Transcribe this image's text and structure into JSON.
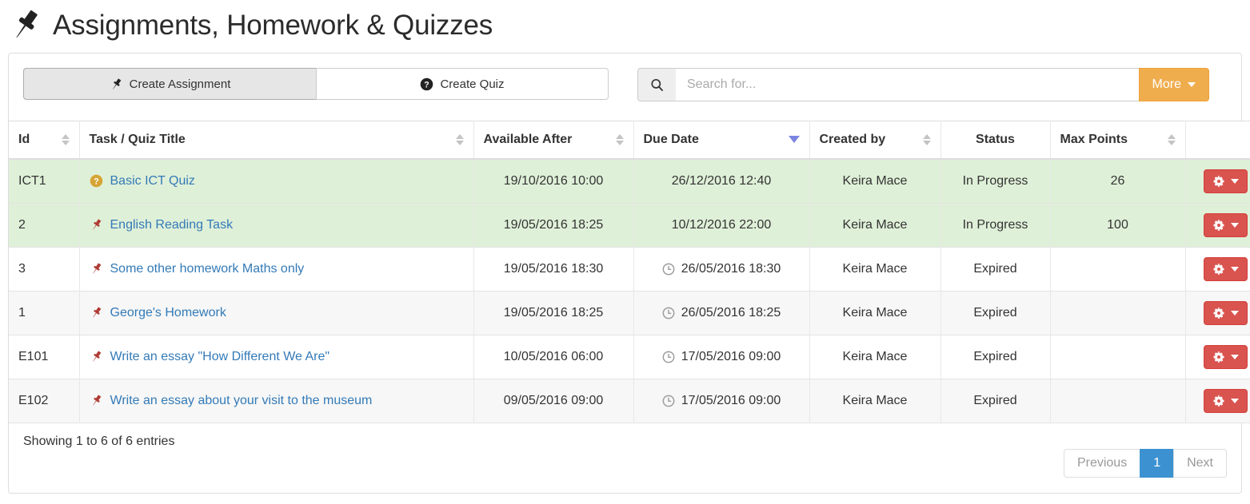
{
  "header": {
    "icon": "pin-icon",
    "title": "Assignments, Homework & Quizzes"
  },
  "toolbar": {
    "create_assignment_label": "Create Assignment",
    "create_assignment_icon": "pin-icon",
    "create_quiz_label": "Create Quiz",
    "create_quiz_icon": "question-circle-icon",
    "search_icon": "search-icon",
    "search_value": "",
    "search_placeholder": "Search for...",
    "more_label": "More",
    "more_caret_icon": "caret-down-icon"
  },
  "table": {
    "columns": [
      {
        "label": "Id",
        "sortable": true,
        "sorted": "none",
        "align": "left"
      },
      {
        "label": "Task / Quiz Title",
        "sortable": true,
        "sorted": "none",
        "align": "left"
      },
      {
        "label": "Available After",
        "sortable": true,
        "sorted": "none",
        "align": "center"
      },
      {
        "label": "Due Date",
        "sortable": true,
        "sorted": "desc",
        "align": "center"
      },
      {
        "label": "Created by",
        "sortable": true,
        "sorted": "none",
        "align": "center"
      },
      {
        "label": "Status",
        "sortable": false,
        "sorted": "none",
        "align": "center"
      },
      {
        "label": "Max Points",
        "sortable": true,
        "sorted": "none",
        "align": "center"
      },
      {
        "label": "",
        "sortable": false,
        "sorted": "none",
        "align": "center"
      }
    ],
    "rows": [
      {
        "id": "ICT1",
        "title": "Basic ICT Quiz",
        "title_icon": "question-circle-icon",
        "available_after": "19/10/2016 10:00",
        "due_date": "26/12/2016 12:40",
        "due_icon": "",
        "created_by": "Keira Mace",
        "status": "In Progress",
        "max_points": "26",
        "action_icon": "gear-icon",
        "action_caret_icon": "caret-down-icon",
        "row_style": "success"
      },
      {
        "id": "2",
        "title": "English Reading Task",
        "title_icon": "pin-icon",
        "available_after": "19/05/2016 18:25",
        "due_date": "10/12/2016 22:00",
        "due_icon": "",
        "created_by": "Keira Mace",
        "status": "In Progress",
        "max_points": "100",
        "action_icon": "gear-icon",
        "action_caret_icon": "caret-down-icon",
        "row_style": "success"
      },
      {
        "id": "3",
        "title": "Some other homework Maths only",
        "title_icon": "pin-icon",
        "available_after": "19/05/2016 18:30",
        "due_date": "26/05/2016 18:30",
        "due_icon": "clock-icon",
        "created_by": "Keira Mace",
        "status": "Expired",
        "max_points": "",
        "action_icon": "gear-icon",
        "action_caret_icon": "caret-down-icon",
        "row_style": "odd"
      },
      {
        "id": "1",
        "title": "George's Homework",
        "title_icon": "pin-icon",
        "available_after": "19/05/2016 18:25",
        "due_date": "26/05/2016 18:25",
        "due_icon": "clock-icon",
        "created_by": "Keira Mace",
        "status": "Expired",
        "max_points": "",
        "action_icon": "gear-icon",
        "action_caret_icon": "caret-down-icon",
        "row_style": "even"
      },
      {
        "id": "E101",
        "title": "Write an essay \"How Different We Are\"",
        "title_icon": "pin-icon",
        "available_after": "10/05/2016 06:00",
        "due_date": "17/05/2016 09:00",
        "due_icon": "clock-icon",
        "created_by": "Keira Mace",
        "status": "Expired",
        "max_points": "",
        "action_icon": "gear-icon",
        "action_caret_icon": "caret-down-icon",
        "row_style": "odd"
      },
      {
        "id": "E102",
        "title": "Write an essay about your visit to the museum",
        "title_icon": "pin-icon",
        "available_after": "09/05/2016 09:00",
        "due_date": "17/05/2016 09:00",
        "due_icon": "clock-icon",
        "created_by": "Keira Mace",
        "status": "Expired",
        "max_points": "",
        "action_icon": "gear-icon",
        "action_caret_icon": "caret-down-icon",
        "row_style": "even"
      }
    ]
  },
  "footer": {
    "entries_info": "Showing 1 to 6 of 6 entries",
    "pagination": {
      "previous_label": "Previous",
      "next_label": "Next",
      "pages": [
        "1"
      ],
      "active_page": "1"
    }
  },
  "colors": {
    "accent_orange": "#f0ad4e",
    "link_blue": "#337ab7",
    "active_page_blue": "#3c92d0",
    "row_success_green": "#dff0d8",
    "action_red": "#d9534f",
    "pin_red": "#b03a32",
    "quiz_gold": "#d6a435",
    "sort_active_blue": "#7b85e0"
  }
}
